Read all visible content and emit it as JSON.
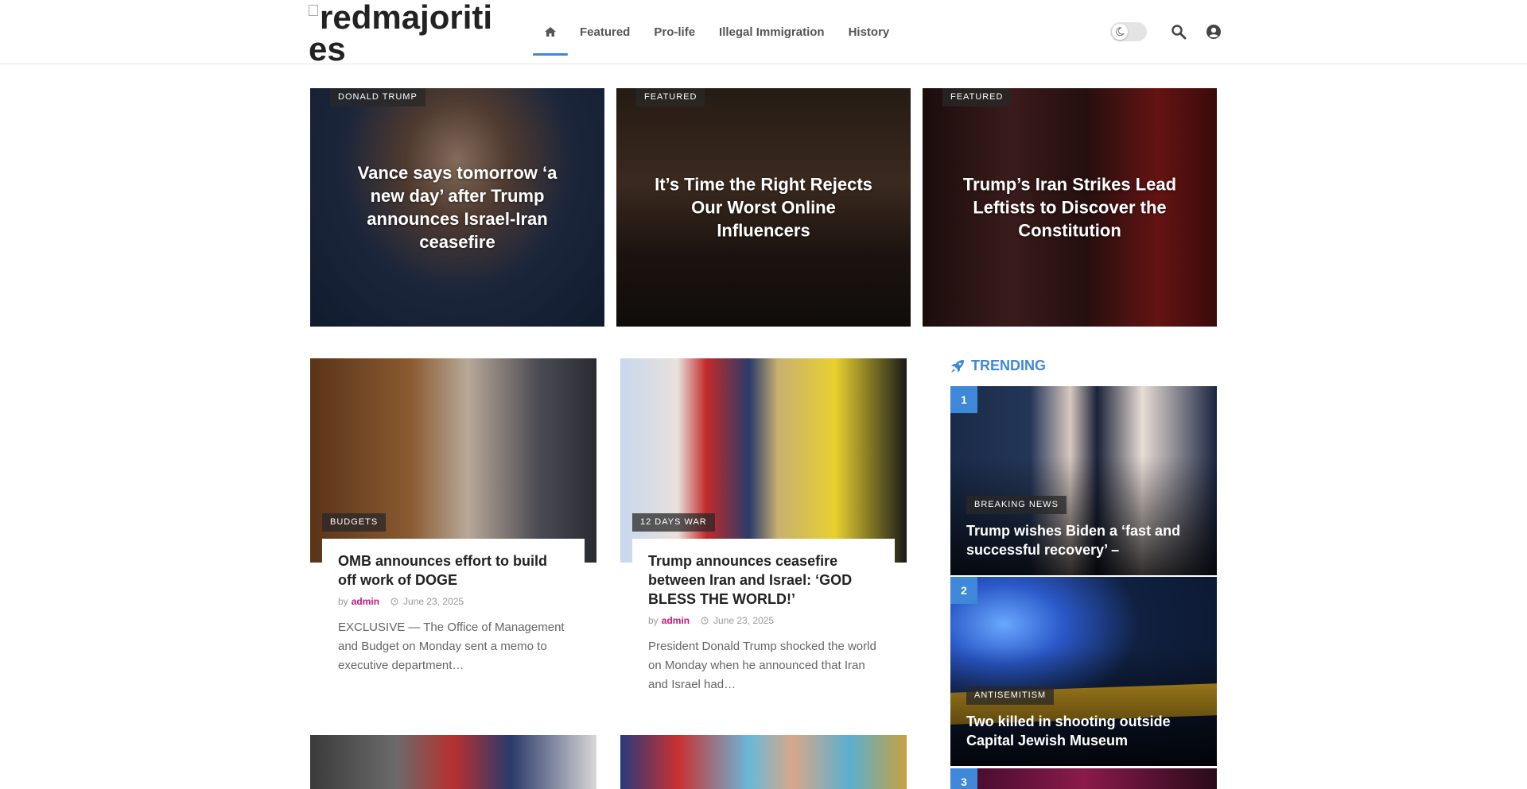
{
  "header": {
    "logo_text": "redmajorities",
    "nav": [
      "Featured",
      "Pro-life",
      "Illegal Immigration",
      "History"
    ],
    "accent": "#3f87d8"
  },
  "hero": [
    {
      "tag": "Donald Trump",
      "title": "Vance says tomorrow ‘a new day’ after Trump announces Israel-Iran ceasefire"
    },
    {
      "tag": "Featured",
      "title": "It’s Time the Right Rejects Our Worst Online Influencers"
    },
    {
      "tag": "Featured",
      "title": "Trump’s Iran Strikes Lead Leftists to Discover the Constitution"
    }
  ],
  "articles": [
    {
      "tag": "Budgets",
      "title": "OMB announces effort to build off work of DOGE",
      "by": "by",
      "author": "admin",
      "date": "June 23, 2025",
      "excerpt": "EXCLUSIVE — The Office of Management and Budget on Monday sent a memo to executive department…"
    },
    {
      "tag": "12 Days War",
      "title": "Trump announces ceasefire between Iran and Israel: ‘GOD BLESS THE WORLD!’",
      "by": "by",
      "author": "admin",
      "date": "June 23, 2025",
      "excerpt": "President Donald Trump shocked the world on Monday when he announced that Iran and Israel had…"
    }
  ],
  "trending": {
    "heading": "TRENDING",
    "items": [
      {
        "num": "1",
        "tag": "Breaking News",
        "title": "Trump wishes Biden a ‘fast and successful recovery’ –"
      },
      {
        "num": "2",
        "tag": "Antisemitism",
        "title": "Two killed in shooting outside Capital Jewish Museum"
      },
      {
        "num": "3"
      }
    ]
  }
}
